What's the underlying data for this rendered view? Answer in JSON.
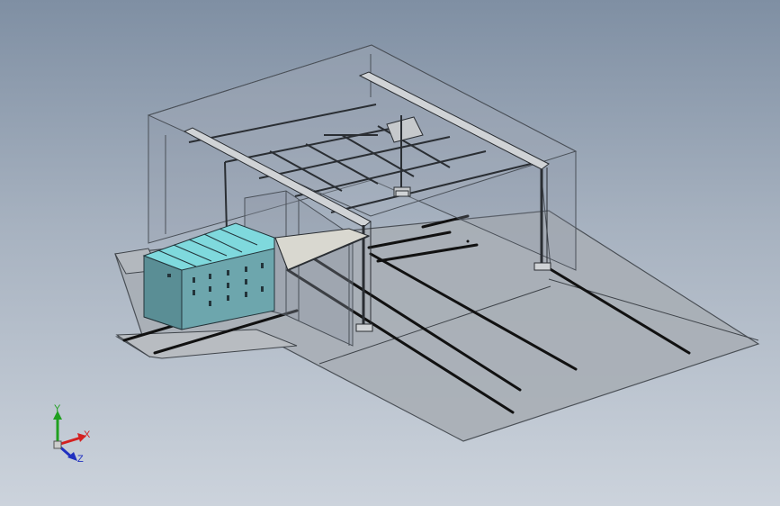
{
  "viewport": {
    "background_top": "#7f8fa3",
    "background_bottom": "#ccd3dc"
  },
  "model": {
    "floor_color": "#a9afb6",
    "floor_edge_color": "#3f444a",
    "rail_color": "#111111",
    "enclosure_edge_color": "#4a5058",
    "gantry_color": "#d0d3d6",
    "cabinet_front_color": "#6da6ad",
    "cabinet_top_color": "#7fd9dd",
    "cabinet_count": 6
  },
  "triad": {
    "x_label": "X",
    "y_label": "Y",
    "z_label": "Z",
    "x_color": "#d42020",
    "y_color": "#20a020",
    "z_color": "#2030c0"
  }
}
